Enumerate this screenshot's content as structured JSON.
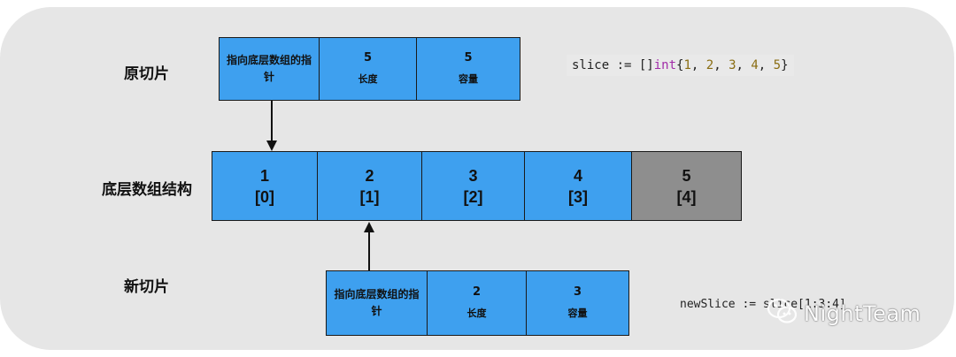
{
  "labels": {
    "original_slice": "原切片",
    "underlying_array": "底层数组结构",
    "new_slice": "新切片"
  },
  "original_slice": {
    "pointer_label": "指向底层数组的指针",
    "length_value": "5",
    "length_label": "长度",
    "capacity_value": "5",
    "capacity_label": "容量"
  },
  "new_slice": {
    "pointer_label": "指向底层数组的指针",
    "length_value": "2",
    "length_label": "长度",
    "capacity_value": "3",
    "capacity_label": "容量"
  },
  "array": [
    {
      "value": "1",
      "index": "[0]",
      "color": "#3ea0ef"
    },
    {
      "value": "2",
      "index": "[1]",
      "color": "#3ea0ef"
    },
    {
      "value": "3",
      "index": "[2]",
      "color": "#3ea0ef"
    },
    {
      "value": "4",
      "index": "[3]",
      "color": "#3ea0ef"
    },
    {
      "value": "5",
      "index": "[4]",
      "color": "#8e8e8e"
    }
  ],
  "code": {
    "original": {
      "name": "slice",
      "op": " := ",
      "brackets": "[]",
      "type": "int",
      "open": "{",
      "n1": "1",
      "n2": "2",
      "n3": "3",
      "n4": "4",
      "n5": "5",
      "sep": ", ",
      "close": "}"
    },
    "new": "newSlice := slice[1:3:4]"
  },
  "watermark": {
    "icon": "wechat-icon",
    "text": "NightTeam"
  },
  "colors": {
    "cell_blue": "#3ea0ef",
    "cell_gray": "#8e8e8e",
    "panel": "#e6e6e6",
    "keyword": "#a12ca8",
    "number": "#8a6d12"
  }
}
